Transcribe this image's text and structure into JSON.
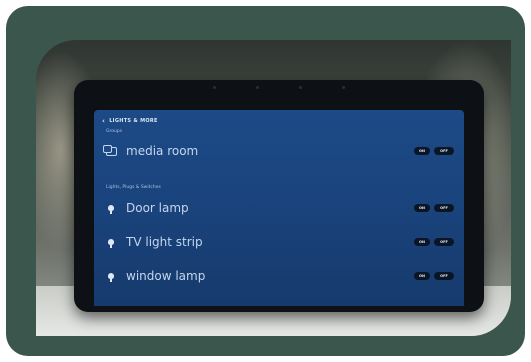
{
  "screen": {
    "back_label": "‹",
    "header": "LIGHTS & MORE",
    "groups_label": "Groups",
    "devices_label": "Lights, Plugs & Switches",
    "groups": [
      {
        "name": "media room",
        "icon": "group-icon",
        "on_label": "ON",
        "off_label": "OFF"
      }
    ],
    "devices": [
      {
        "name": "Door lamp",
        "icon": "bulb-icon",
        "on_label": "ON",
        "off_label": "OFF"
      },
      {
        "name": "TV light strip",
        "icon": "bulb-icon",
        "on_label": "ON",
        "off_label": "OFF"
      },
      {
        "name": "window lamp",
        "icon": "bulb-icon",
        "on_label": "ON",
        "off_label": "OFF"
      }
    ]
  },
  "colors": {
    "frame": "#3b564d",
    "screen": "#1c4a86",
    "button": "#0a1526"
  }
}
